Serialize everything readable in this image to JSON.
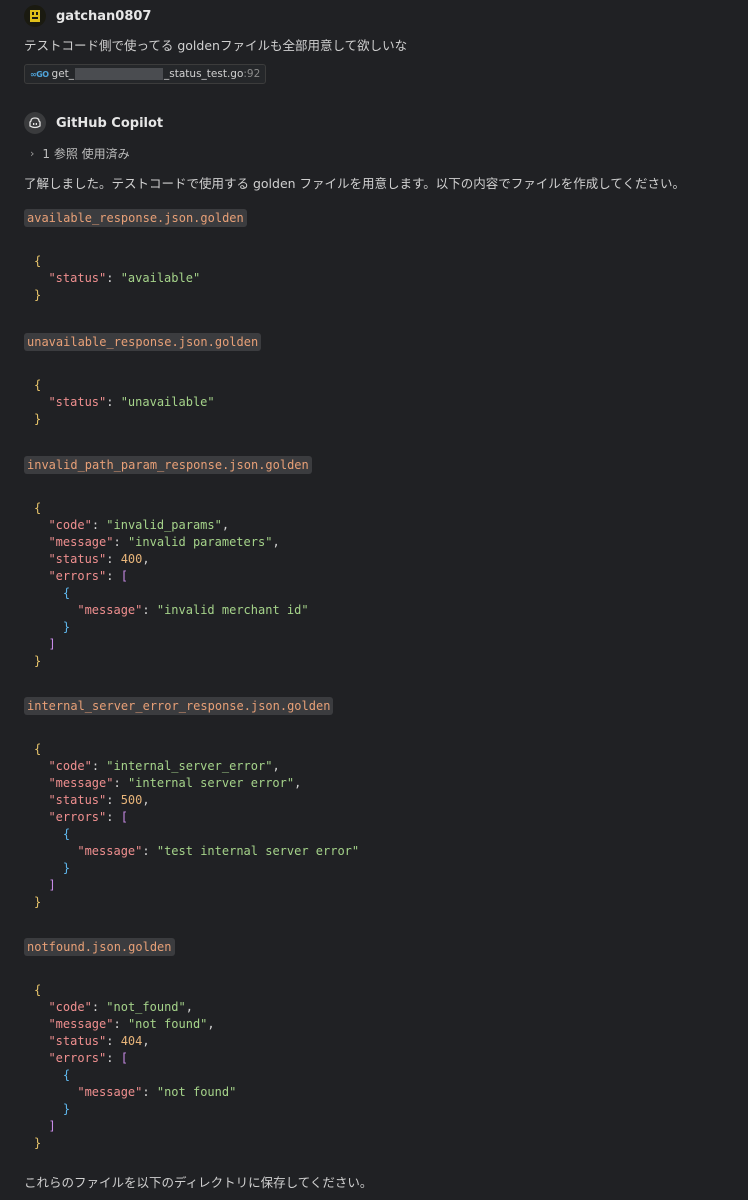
{
  "user": {
    "name": "gatchan0807",
    "message": "テストコード側で使ってる goldenファイルも全部用意して欲しいな",
    "file_ref": {
      "prefix": "get_",
      "suffix": "_status_test.go",
      "line": ":92"
    }
  },
  "assistant": {
    "name": "GitHub Copilot",
    "references": "1 参照 使用済み",
    "intro": "了解しました。テストコードで使用する golden ファイルを用意します。以下の内容でファイルを作成してください。",
    "files": [
      {
        "name": "available_response.json.golden"
      },
      {
        "name": "unavailable_response.json.golden"
      },
      {
        "name": "invalid_path_param_response.json.golden"
      },
      {
        "name": "internal_server_error_response.json.golden"
      },
      {
        "name": "notfound.json.golden"
      }
    ],
    "code": {
      "f1": {
        "status": "\"available\""
      },
      "f2": {
        "status": "\"unavailable\""
      },
      "f3": {
        "code": "\"invalid_params\"",
        "message": "\"invalid parameters\"",
        "status": "400",
        "err_message": "\"invalid merchant id\""
      },
      "f4": {
        "code": "\"internal_server_error\"",
        "message": "\"internal server error\"",
        "status": "500",
        "err_message": "\"test internal server error\""
      },
      "f5": {
        "code": "\"not_found\"",
        "message": "\"not found\"",
        "status": "404",
        "err_message": "\"not found\""
      }
    },
    "keys": {
      "code": "\"code\"",
      "message": "\"message\"",
      "status": "\"status\"",
      "errors": "\"errors\""
    },
    "outro": "これらのファイルを以下のディレクトリに保存してください。"
  }
}
